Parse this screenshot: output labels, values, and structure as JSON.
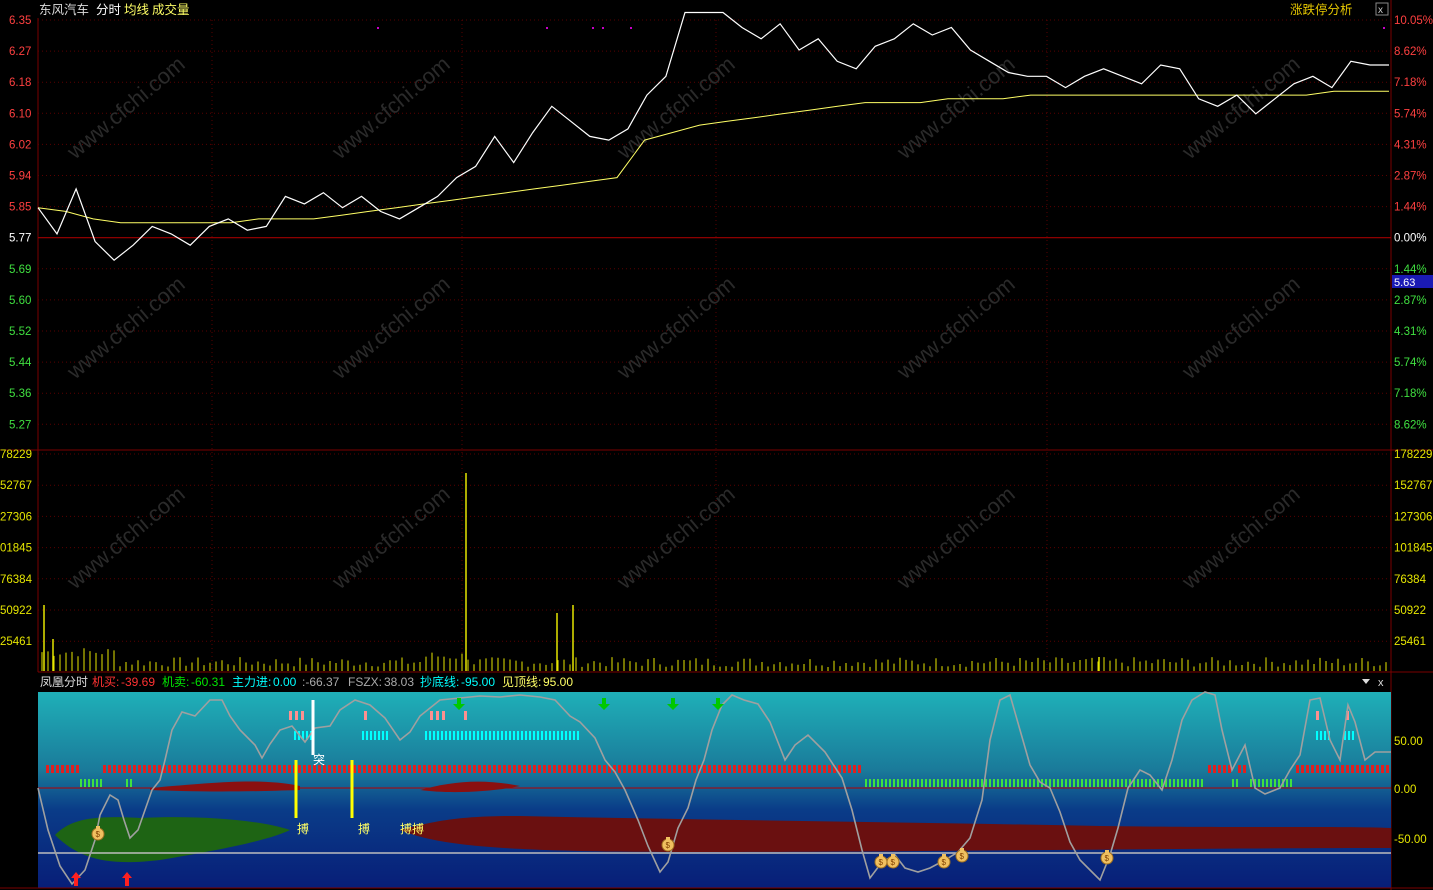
{
  "header": {
    "stock_name": "东风汽车",
    "menu_intraday": "分时",
    "menu_avg_line": "均线",
    "menu_volume": "成交量",
    "limit_analysis_button": "涨跌停分析"
  },
  "price_panel": {
    "left_axis": [
      "6.35",
      "6.27",
      "6.18",
      "6.10",
      "6.02",
      "5.94",
      "5.85",
      "5.77",
      "5.69",
      "5.60",
      "5.52",
      "5.44",
      "5.36",
      "5.27"
    ],
    "right_axis": [
      "10.05%",
      "8.62%",
      "7.18%",
      "5.74%",
      "4.31%",
      "2.87%",
      "1.44%",
      "0.00%",
      "1.44%",
      "2.87%",
      "4.31%",
      "5.74%",
      "7.18%",
      "8.62%"
    ],
    "cursor_price": "5.63",
    "price_series": [
      5.85,
      5.78,
      5.9,
      5.76,
      5.71,
      5.75,
      5.8,
      5.78,
      5.75,
      5.8,
      5.82,
      5.79,
      5.8,
      5.88,
      5.86,
      5.89,
      5.85,
      5.88,
      5.84,
      5.82,
      5.85,
      5.88,
      5.93,
      5.96,
      6.04,
      5.97,
      6.05,
      6.12,
      6.08,
      6.04,
      6.03,
      6.06,
      6.15,
      6.2,
      6.37,
      6.37,
      6.37,
      6.33,
      6.3,
      6.34,
      6.27,
      6.3,
      6.24,
      6.22,
      6.28,
      6.3,
      6.34,
      6.31,
      6.33,
      6.27,
      6.24,
      6.21,
      6.2,
      6.2,
      6.17,
      6.2,
      6.22,
      6.2,
      6.18,
      6.23,
      6.22,
      6.14,
      6.12,
      6.15,
      6.1,
      6.14,
      6.18,
      6.2,
      6.17,
      6.24,
      6.23,
      6.23
    ],
    "avg_series": [
      5.85,
      5.84,
      5.82,
      5.81,
      5.81,
      5.81,
      5.81,
      5.81,
      5.82,
      5.82,
      5.82,
      5.83,
      5.84,
      5.85,
      5.86,
      5.87,
      5.88,
      5.89,
      5.9,
      5.91,
      5.92,
      5.93,
      6.03,
      6.05,
      6.07,
      6.08,
      6.09,
      6.1,
      6.11,
      6.12,
      6.13,
      6.13,
      6.13,
      6.14,
      6.14,
      6.14,
      6.15,
      6.15,
      6.15,
      6.15,
      6.15,
      6.15,
      6.15,
      6.15,
      6.15,
      6.15,
      6.15,
      6.16,
      6.16,
      6.16
    ]
  },
  "volume_panel": {
    "left_axis": [
      "78229",
      "52767",
      "27306",
      "01845",
      "76384",
      "50922",
      "25461"
    ],
    "right_axis": [
      "178229",
      "152767",
      "127306",
      "101845",
      "76384",
      "50922",
      "25461"
    ]
  },
  "indicator_panel": {
    "name": "凤凰分时",
    "buy_label": "机买:",
    "buy_value": "-39.69",
    "sell_label": "机卖:",
    "sell_value": "-60.31",
    "main_in_label": "主力进:",
    "main_in_value": "0.00",
    "extra_value": ":-66.37",
    "fszx_label": "FSZX:",
    "fszx_value": "38.03",
    "bottom_line_label": "抄底线:",
    "bottom_line_value": "-95.00",
    "top_line_label": "见顶线:",
    "top_line_value": "95.00",
    "axis": [
      "50.00",
      "0.00",
      "-50.00"
    ],
    "marker_tu": "突",
    "marker_bo": "搏",
    "marker_bobo": "搏搏"
  },
  "watermark_text": "www.cfchi.com",
  "colors": {
    "price_line": "#ffffff",
    "avg_line": "#ffff66",
    "up_red": "#ff3232",
    "down_green": "#00e600",
    "grid_red": "#7a0000",
    "axis_yellow": "#e6e600",
    "cyan": "#00ffff"
  }
}
